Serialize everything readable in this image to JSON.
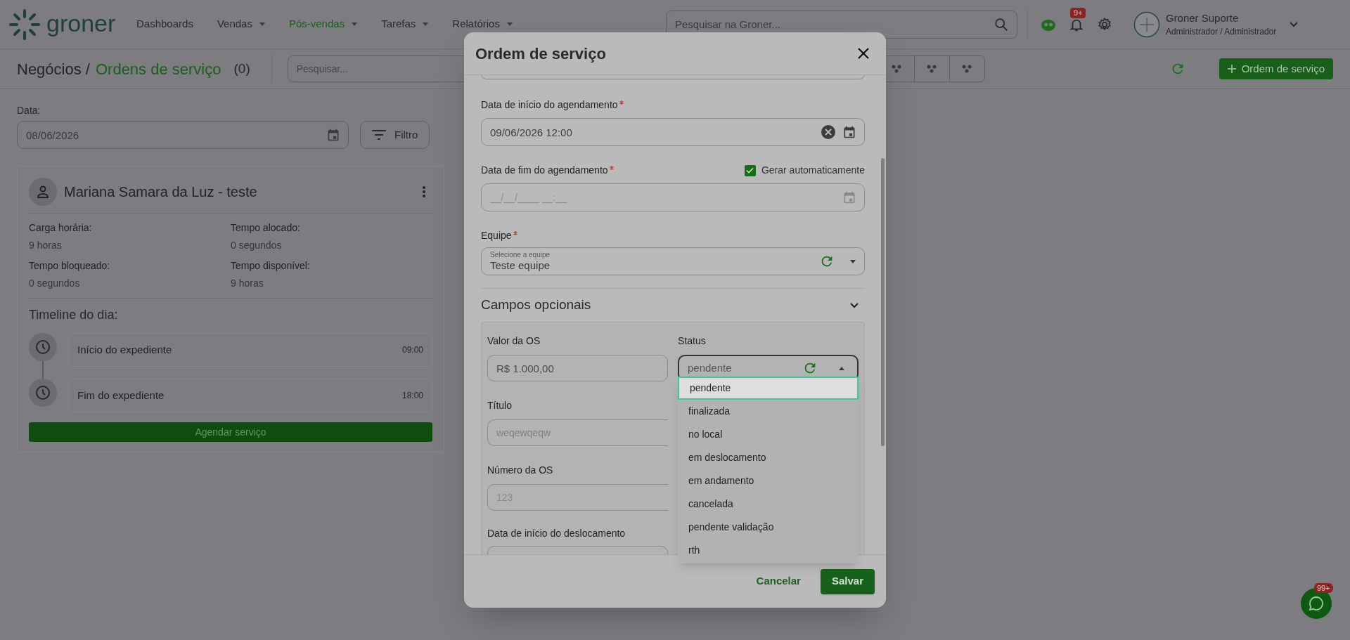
{
  "header": {
    "logo": "groner",
    "nav": [
      {
        "label": "Dashboards",
        "dropdown": false,
        "selected": false
      },
      {
        "label": "Vendas",
        "dropdown": true,
        "selected": false
      },
      {
        "label": "Pós-vendas",
        "dropdown": true,
        "selected": true
      },
      {
        "label": "Tarefas",
        "dropdown": true,
        "selected": false
      },
      {
        "label": "Relatórios",
        "dropdown": true,
        "selected": false
      }
    ],
    "search": {
      "placeholder": "Pesquisar na Groner..."
    },
    "notifications_badge": "9+",
    "user": {
      "name": "Groner Suporte",
      "role": "Administrador / Administrador"
    }
  },
  "toolbar": {
    "breadcrumb": "Negócios /",
    "title": "Ordens de serviço",
    "count": "(0)",
    "search": {
      "placeholder": "Pesquisar..."
    },
    "new_button": "Ordem de serviço"
  },
  "filters": {
    "date_label": "Data:",
    "date_value": "08/06/2026",
    "filter_button": "Filtro"
  },
  "card": {
    "name": "Mariana Samara da Luz - teste",
    "stats": [
      {
        "label": "Carga horária:",
        "value": "9 horas"
      },
      {
        "label": "Tempo alocado:",
        "value": "0 segundos"
      },
      {
        "label": "Tempo bloqueado:",
        "value": "0 segundos"
      },
      {
        "label": "Tempo disponível:",
        "value": "9 horas"
      }
    ],
    "timeline_title": "Timeline do dia:",
    "timeline": [
      {
        "label": "Início do expediente",
        "time": "09:00"
      },
      {
        "label": "Fim do expediente",
        "time": "18:00"
      }
    ],
    "action": "Agendar serviço"
  },
  "modal": {
    "title": "Ordem de serviço",
    "start_date": {
      "label": "Data de início do agendamento",
      "required": true,
      "value": "09/06/2026 12:00"
    },
    "end_date": {
      "label": "Data de fim do agendamento",
      "required": true,
      "placeholder": "__/__/____ __:__",
      "auto": {
        "label": "Gerar automaticamente",
        "checked": true
      }
    },
    "team": {
      "label": "Equipe",
      "required": true,
      "floating_label": "Selecione a equipe",
      "value": "Teste equipe"
    },
    "optional": {
      "title": "Campos opcionais",
      "expanded": true,
      "value": {
        "label": "Valor da OS",
        "value": "R$ 1.000,00"
      },
      "status": {
        "label": "Status",
        "value": "pendente",
        "open": true,
        "options": [
          {
            "label": "pendente",
            "selected": true
          },
          {
            "label": "finalizada",
            "selected": false
          },
          {
            "label": "no local",
            "selected": false
          },
          {
            "label": "em deslocamento",
            "selected": false
          },
          {
            "label": "em andamento",
            "selected": false
          },
          {
            "label": "cancelada",
            "selected": false
          },
          {
            "label": "pendente validação",
            "selected": false
          },
          {
            "label": "rth",
            "selected": false
          }
        ]
      },
      "title_field": {
        "label": "Título",
        "placeholder": "weqewqeqw"
      },
      "number_field": {
        "label": "Número da OS",
        "placeholder": "123"
      },
      "travel_start": {
        "label": "Data de início do deslocamento"
      }
    },
    "cancel": "Cancelar",
    "save": "Salvar"
  },
  "chat_badge": "99+"
}
